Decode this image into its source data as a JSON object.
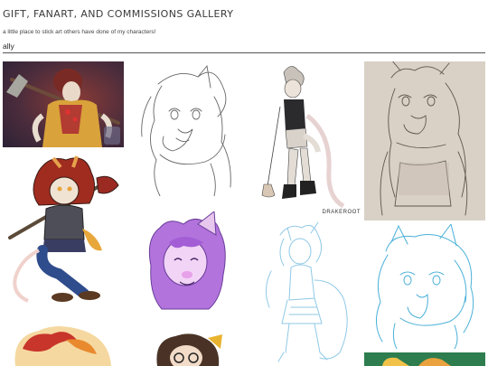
{
  "header": {
    "title": "GIFT, FANART, AND COMMISSIONS GALLERY",
    "subtitle": "a little place to stick art others have done of my characters!"
  },
  "filter": {
    "value": "ally"
  },
  "gallery": {
    "tiles": [
      {
        "name": "gallery-tile-shovel-painting",
        "watermark": ""
      },
      {
        "name": "gallery-tile-sketch-lineart",
        "watermark": ""
      },
      {
        "name": "gallery-tile-shovel-standing",
        "watermark": "DRAKEROOT"
      },
      {
        "name": "gallery-tile-pencil-sketch",
        "watermark": ""
      },
      {
        "name": "gallery-tile-chibi-shovel",
        "watermark": ""
      },
      {
        "name": "gallery-tile-purple-headshot",
        "watermark": ""
      },
      {
        "name": "gallery-tile-blue-sketch-fullbody",
        "watermark": ""
      },
      {
        "name": "gallery-tile-blue-sketch-bust",
        "watermark": ""
      },
      {
        "name": "gallery-tile-orange-partial",
        "watermark": ""
      },
      {
        "name": "gallery-tile-glasses-partial",
        "watermark": ""
      },
      {
        "name": "gallery-tile-green-partial",
        "watermark": ""
      }
    ]
  },
  "colors": {
    "accent_red": "#9b2a22",
    "purple": "#b07ad9",
    "sketch_blue": "#7cc0e0",
    "green_bg": "#2e7d4f"
  }
}
